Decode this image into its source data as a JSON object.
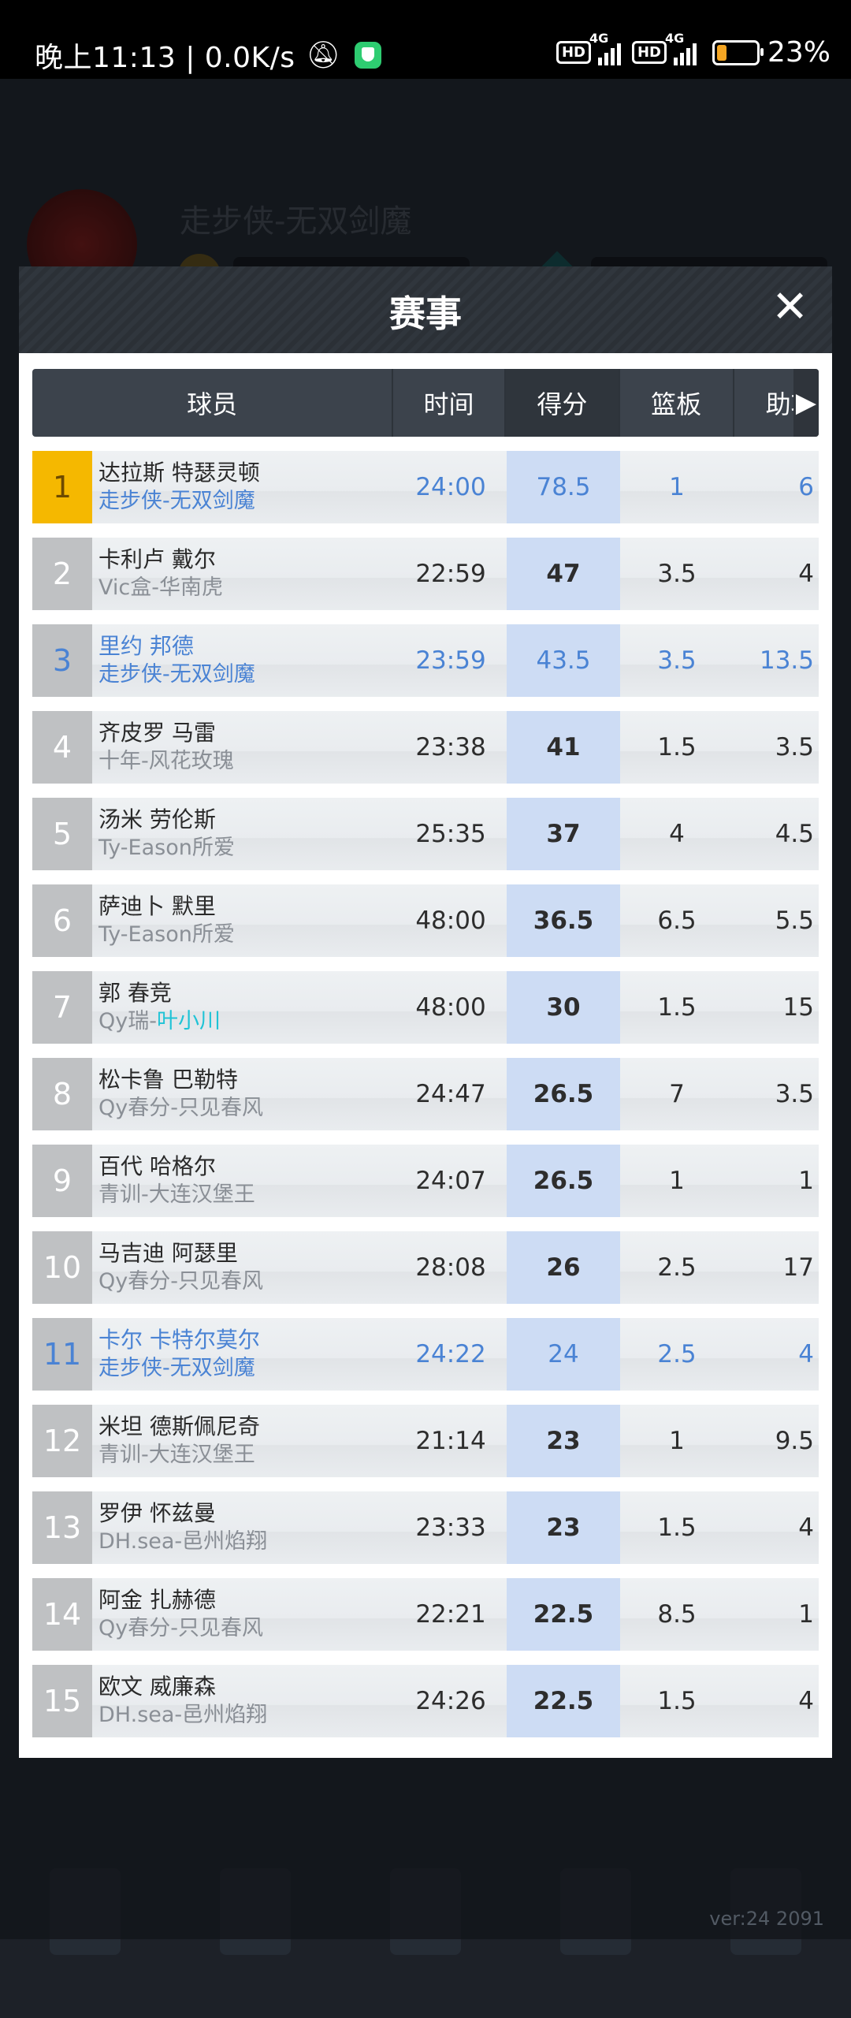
{
  "status_bar": {
    "left_text": "晚上11:13 | 0.0K/s",
    "battery_text": "23%",
    "hd1": "HD",
    "hd2": "HD",
    "net1": "4G",
    "net2": "4G"
  },
  "background": {
    "name": "走步侠-无双剑魔",
    "version": "ver:24  2091"
  },
  "modal": {
    "title": "赛事",
    "close_glyph": "✕",
    "columns": [
      "球员",
      "时间",
      "得分",
      "篮板",
      "助攻"
    ],
    "rows": [
      {
        "rank": "1",
        "name": "达拉斯 特瑟灵顿",
        "team": "走步侠-无双剑魔",
        "time": "24:00",
        "score": "78.5",
        "reb": "1",
        "ast": "6",
        "style": "gold"
      },
      {
        "rank": "2",
        "name": "卡利卢 戴尔",
        "team": "Vic盒-华南虎",
        "time": "22:59",
        "score": "47",
        "reb": "3.5",
        "ast": "4",
        "style": ""
      },
      {
        "rank": "3",
        "name": "里约 邦德",
        "team": "走步侠-无双剑魔",
        "time": "23:59",
        "score": "43.5",
        "reb": "3.5",
        "ast": "13.5",
        "style": "hl"
      },
      {
        "rank": "4",
        "name": "齐皮罗 马雷",
        "team": "十年-风花玫瑰",
        "time": "23:38",
        "score": "41",
        "reb": "1.5",
        "ast": "3.5",
        "style": ""
      },
      {
        "rank": "5",
        "name": "汤米 劳伦斯",
        "team": "Ty-Eason所爱",
        "time": "25:35",
        "score": "37",
        "reb": "4",
        "ast": "4.5",
        "style": ""
      },
      {
        "rank": "6",
        "name": "萨迪卜 默里",
        "team": "Ty-Eason所爱",
        "time": "48:00",
        "score": "36.5",
        "reb": "6.5",
        "ast": "5.5",
        "style": ""
      },
      {
        "rank": "7",
        "name": "郭 春竞",
        "team_prefix": "Qy瑞-",
        "team_suffix": "叶小川",
        "time": "48:00",
        "score": "30",
        "reb": "1.5",
        "ast": "15",
        "style": ""
      },
      {
        "rank": "8",
        "name": "松卡鲁 巴勒特",
        "team": "Qy春分-只见春风",
        "time": "24:47",
        "score": "26.5",
        "reb": "7",
        "ast": "3.5",
        "style": ""
      },
      {
        "rank": "9",
        "name": "百代 哈格尔",
        "team": "青训-大连汉堡王",
        "time": "24:07",
        "score": "26.5",
        "reb": "1",
        "ast": "1",
        "style": ""
      },
      {
        "rank": "10",
        "name": "马吉迪 阿瑟里",
        "team": "Qy春分-只见春风",
        "time": "28:08",
        "score": "26",
        "reb": "2.5",
        "ast": "17",
        "style": ""
      },
      {
        "rank": "11",
        "name": "卡尔 卡特尔莫尔",
        "team": "走步侠-无双剑魔",
        "time": "24:22",
        "score": "24",
        "reb": "2.5",
        "ast": "4",
        "style": "hl"
      },
      {
        "rank": "12",
        "name": "米坦 德斯佩尼奇",
        "team": "青训-大连汉堡王",
        "time": "21:14",
        "score": "23",
        "reb": "1",
        "ast": "9.5",
        "style": ""
      },
      {
        "rank": "13",
        "name": "罗伊 怀兹曼",
        "team": "DH.sea-邑州焰翔",
        "time": "23:33",
        "score": "23",
        "reb": "1.5",
        "ast": "4",
        "style": ""
      },
      {
        "rank": "14",
        "name": "阿金 扎赫德",
        "team": "Qy春分-只见春风",
        "time": "22:21",
        "score": "22.5",
        "reb": "8.5",
        "ast": "1",
        "style": ""
      },
      {
        "rank": "15",
        "name": "欧文 威廉森",
        "team": "DH.sea-邑州焰翔",
        "time": "24:26",
        "score": "22.5",
        "reb": "1.5",
        "ast": "4",
        "style": ""
      }
    ]
  },
  "colors": {
    "highlight_blue": "#4a83d4",
    "gold": "#f5b800",
    "score_column_bg": "#cddcf4"
  }
}
